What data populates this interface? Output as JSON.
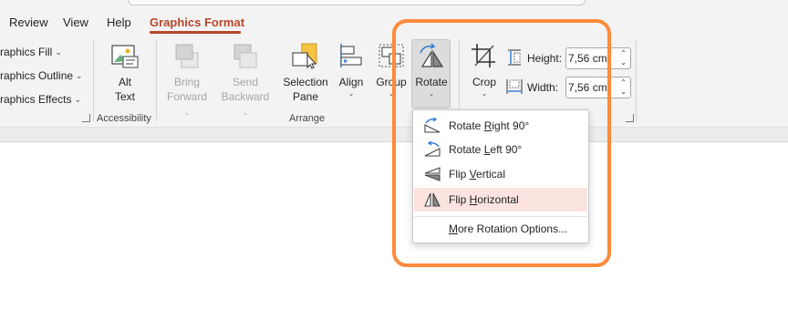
{
  "tabs": [
    {
      "label": "Review",
      "active": false
    },
    {
      "label": "View",
      "active": false
    },
    {
      "label": "Help",
      "active": false
    },
    {
      "label": "Graphics Format",
      "active": true
    }
  ],
  "ribbon": {
    "styles_group": {
      "items": [
        "raphics Fill",
        "raphics Outline",
        "raphics Effects"
      ]
    },
    "accessibility": {
      "alt_text": {
        "line1": "Alt",
        "line2": "Text"
      },
      "group_label": "Accessibility"
    },
    "arrange": {
      "bring_forward": {
        "line1": "Bring",
        "line2": "Forward"
      },
      "send_backward": {
        "line1": "Send",
        "line2": "Backward"
      },
      "selection_pane": {
        "line1": "Selection",
        "line2": "Pane"
      },
      "align": {
        "label": "Align"
      },
      "group": {
        "label": "Group"
      },
      "rotate": {
        "label": "Rotate"
      },
      "group_label": "Arrange"
    },
    "size": {
      "crop": {
        "label": "Crop"
      },
      "height_label": "Height:",
      "height_value": "7,56 cm",
      "width_label": "Width:",
      "width_value": "7,56 cm"
    }
  },
  "rotate_menu": {
    "items": [
      {
        "pre": "Rotate ",
        "u": "R",
        "post": "ight 90°",
        "icon": "rotate-right-icon"
      },
      {
        "pre": "Rotate ",
        "u": "L",
        "post": "eft 90°",
        "icon": "rotate-left-icon"
      },
      {
        "pre": "Flip ",
        "u": "V",
        "post": "ertical",
        "icon": "flip-vertical-icon"
      },
      {
        "pre": "Flip ",
        "u": "H",
        "post": "orizontal",
        "icon": "flip-horizontal-icon",
        "hovered": true
      },
      {
        "pre": "",
        "u": "M",
        "post": "ore Rotation Options...",
        "icon": ""
      }
    ]
  },
  "colors": {
    "accent": "#b7472a",
    "highlight_outline": "#ff8a3d",
    "menu_hover": "#fbe3df",
    "icon_blue": "#2b7cd3"
  }
}
